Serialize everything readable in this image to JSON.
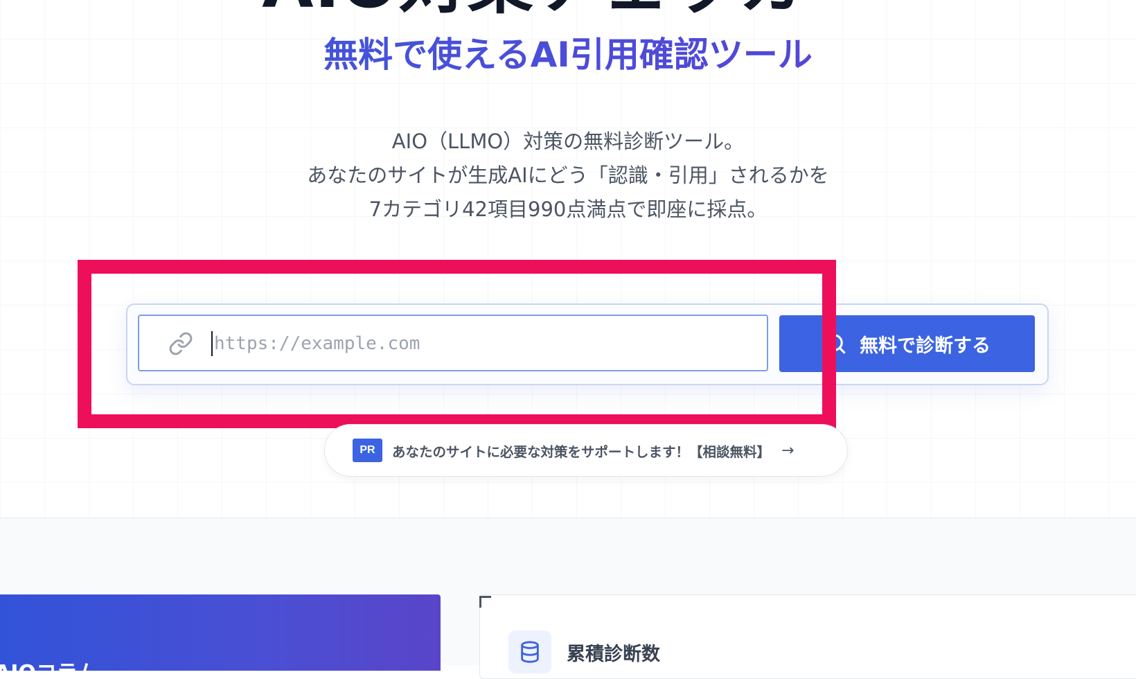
{
  "hero": {
    "title": "AIO対策チェッカー",
    "subtitle": "無料で使えるAI引用確認ツール",
    "description": [
      "AIO（LLMO）対策の無料診断ツール。",
      "あなたのサイトが生成AIにどう「認識・引用」されるかを",
      "7カテゴリ42項目990点満点で即座に採点。"
    ]
  },
  "search": {
    "placeholder": "https://example.com",
    "value": "",
    "button_label": "無料で診断する",
    "link_icon": "link-icon",
    "button_icon": "search-icon"
  },
  "promo": {
    "badge": "PR",
    "text": "あなたのサイトに必要な対策をサポートします！【相談無料】",
    "arrow": "→"
  },
  "bottom": {
    "column_card_label": "AIOコラム",
    "stats_label": "累積診断数",
    "stats_icon": "database-icon"
  },
  "colors": {
    "accent": "#3b63e2",
    "highlight": "#ee0f5b",
    "subtitle": "#4b4be6"
  }
}
